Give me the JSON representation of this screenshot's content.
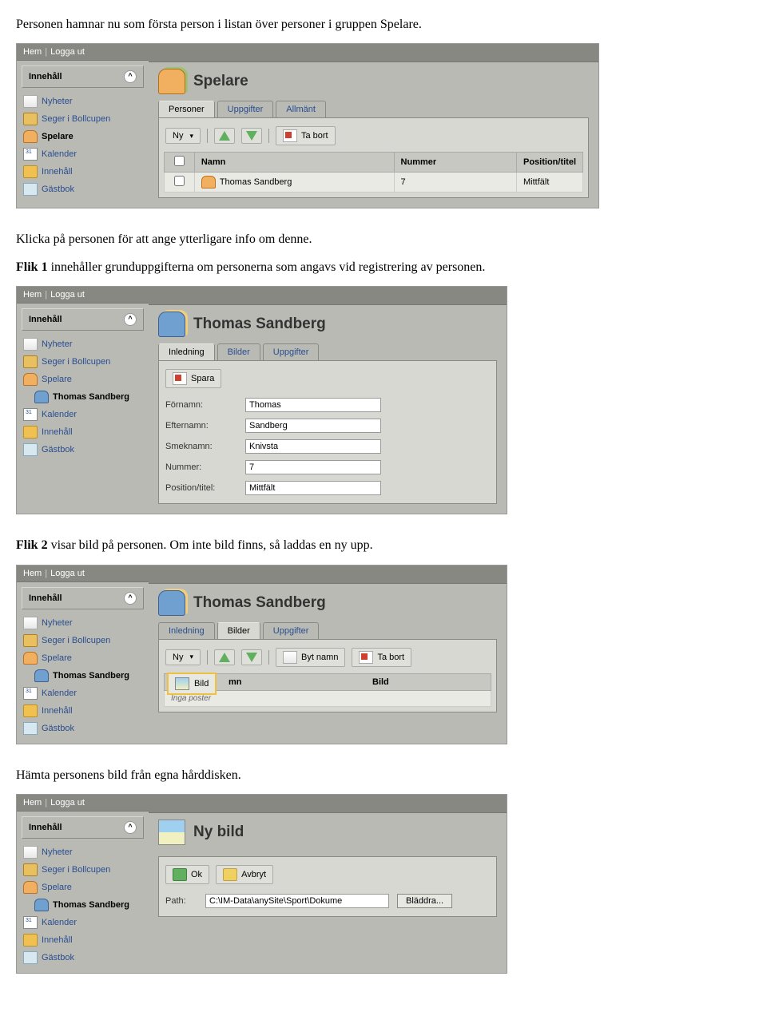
{
  "texts": {
    "p1": "Personen hamnar nu som första person i listan över personer i gruppen Spelare.",
    "p2": "Klicka på personen för att ange ytterligare info om denne.",
    "p3_bold": "Flik 1",
    "p3_rest": " innehåller grunduppgifterna om personerna som angavs vid registrering av personen.",
    "p4_bold": "Flik 2",
    "p4_rest": " visar bild på personen. Om inte bild finns, så laddas en ny upp.",
    "p5": "Hämta personens bild från egna hårddisken."
  },
  "common": {
    "topbar": {
      "hem": "Hem",
      "loggaut": "Logga ut"
    },
    "sidebar_header": "Innehåll",
    "sidebar": {
      "nyheter": "Nyheter",
      "seger": "Seger i Bollcupen",
      "spelare": "Spelare",
      "thomas": "Thomas Sandberg",
      "kalender": "Kalender",
      "innehall": "Innehåll",
      "gastbok": "Gästbok"
    }
  },
  "s1": {
    "title": "Spelare",
    "tabs": {
      "personer": "Personer",
      "uppgifter": "Uppgifter",
      "allmant": "Allmänt"
    },
    "toolbar": {
      "ny": "Ny",
      "tabort": "Ta bort"
    },
    "table": {
      "headers": {
        "namn": "Namn",
        "nummer": "Nummer",
        "position": "Position/titel"
      },
      "row": {
        "namn": "Thomas Sandberg",
        "nummer": "7",
        "position": "Mittfält"
      }
    }
  },
  "s2": {
    "title": "Thomas Sandberg",
    "tabs": {
      "inledning": "Inledning",
      "bilder": "Bilder",
      "uppgifter": "Uppgifter"
    },
    "toolbar": {
      "spara": "Spara"
    },
    "form": {
      "fornamn_l": "Förnamn:",
      "fornamn_v": "Thomas",
      "efternamn_l": "Efternamn:",
      "efternamn_v": "Sandberg",
      "smeknamn_l": "Smeknamn:",
      "smeknamn_v": "Knivsta",
      "nummer_l": "Nummer:",
      "nummer_v": "7",
      "position_l": "Position/titel:",
      "position_v": "Mittfält"
    }
  },
  "s3": {
    "title": "Thomas Sandberg",
    "tabs": {
      "inledning": "Inledning",
      "bilder": "Bilder",
      "uppgifter": "Uppgifter"
    },
    "toolbar": {
      "ny": "Ny",
      "bytnamn": "Byt namn",
      "tabort": "Ta bort"
    },
    "imgtool": "Bild",
    "headers": {
      "mn": "mn",
      "bild": "Bild"
    },
    "empty": "Inga poster"
  },
  "s4": {
    "title": "Ny bild",
    "toolbar": {
      "ok": "Ok",
      "avbryt": "Avbryt"
    },
    "form": {
      "path_l": "Path:",
      "path_v": "C:\\IM-Data\\anySite\\Sport\\Dokume",
      "browse": "Bläddra..."
    }
  }
}
